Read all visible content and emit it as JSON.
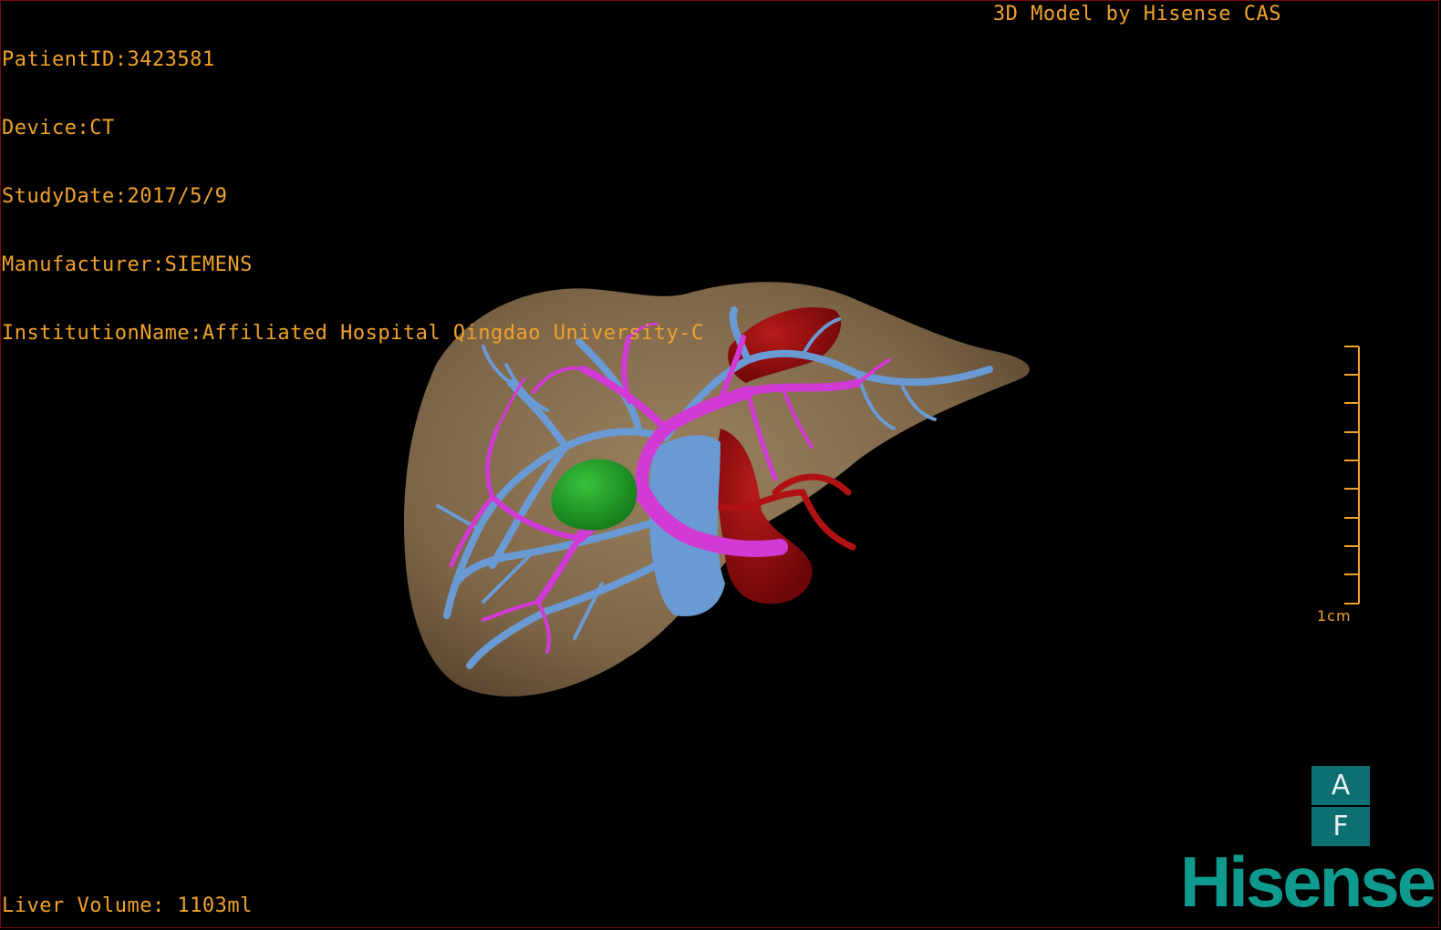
{
  "header": {
    "patient_id": "PatientID:3423581",
    "device": "Device:CT",
    "study_date": "StudyDate:2017/5/9",
    "manufacturer": "Manufacturer:SIEMENS",
    "institution": "InstitutionName:Affiliated Hospital Qingdao University-C",
    "credit": "3D Model by Hisense CAS"
  },
  "footer": {
    "liver_volume": "Liver Volume: 1103ml",
    "brand": "Hisense"
  },
  "scale": {
    "label": "1cm",
    "color": "#f0a22a"
  },
  "orientation": {
    "top": "A",
    "bottom": "F",
    "color": "#0d6f72"
  },
  "model": {
    "structures": [
      "liver",
      "portal-vein",
      "hepatic-vein",
      "hepatic-artery",
      "tumor"
    ],
    "colors": {
      "liver": "#8b7250",
      "portal_vein": "#d23ad6",
      "hepatic_vein": "#6a9ad3",
      "hepatic_artery": "#9a0e10",
      "tumor": "#1f9a25"
    }
  }
}
